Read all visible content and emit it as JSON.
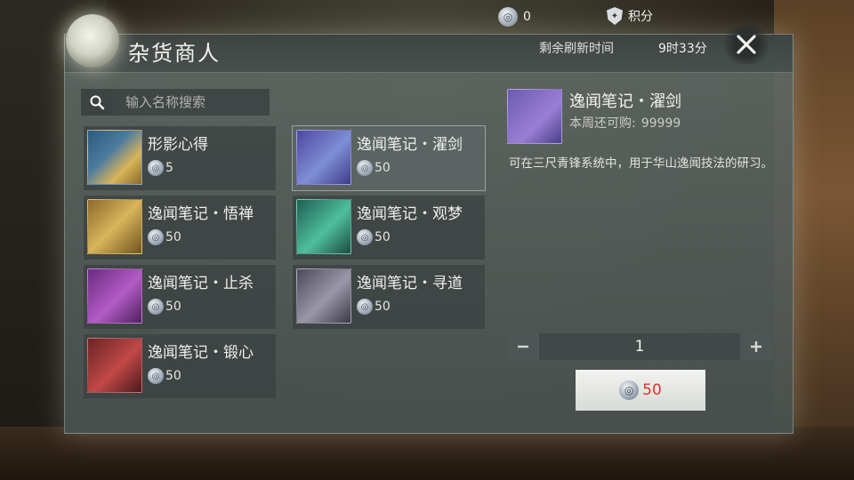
{
  "topbar": {
    "currency_count": "0",
    "points_label": "积分"
  },
  "shop": {
    "title": "杂货商人",
    "refresh_label": "剩余刷新时间",
    "refresh_value": "9时33分"
  },
  "search": {
    "placeholder": "输入名称搜索"
  },
  "items": [
    {
      "name": "形影心得",
      "price": "5",
      "icon": "yellow-scroll-icon",
      "color": "#d8b45a"
    },
    {
      "name": "逸闻笔记・濯剑",
      "price": "50",
      "icon": "blue-book-icon",
      "color": "#7d8fd6"
    },
    {
      "name": "逸闻笔记・悟禅",
      "price": "50",
      "icon": "gold-book-icon",
      "color": "#c89a3c"
    },
    {
      "name": "逸闻笔记・观梦",
      "price": "50",
      "icon": "green-book-icon",
      "color": "#4fbf9c"
    },
    {
      "name": "逸闻笔记・止杀",
      "price": "50",
      "icon": "purple-book-icon",
      "color": "#b25cc4"
    },
    {
      "name": "逸闻笔记・寻道",
      "price": "50",
      "icon": "grey-book-icon",
      "color": "#9a98a8"
    },
    {
      "name": "逸闻笔记・锻心",
      "price": "50",
      "icon": "red-book-icon",
      "color": "#c24848"
    }
  ],
  "detail": {
    "name": "逸闻笔记・濯剑",
    "limit_label": "本周还可购:",
    "limit_value": "99999",
    "description": "可在三尺青锋系统中，用于华山逸闻技法的研习。",
    "quantity": "1",
    "total_price": "50"
  }
}
